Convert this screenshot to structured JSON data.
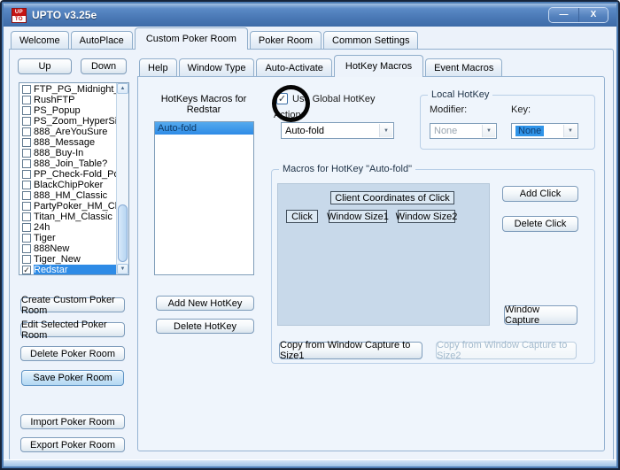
{
  "window": {
    "title": "UPTO  v3.25e",
    "logo": {
      "top": "UP",
      "bottom": "TO"
    },
    "minimize_glyph": "—",
    "close_glyph": "X"
  },
  "tabs": {
    "items": [
      "Welcome",
      "AutoPlace",
      "Custom Poker Room",
      "Poker Room",
      "Common Settings"
    ],
    "active": "Custom Poker Room"
  },
  "inner_tabs": {
    "items": [
      "Help",
      "Window Type",
      "Auto-Activate",
      "HotKey Macros",
      "Event Macros"
    ],
    "active": "HotKey Macros"
  },
  "left": {
    "up_label": "Up",
    "down_label": "Down",
    "rooms": [
      {
        "label": "FTP_PG_Midnight_F",
        "checked": false,
        "selected": false
      },
      {
        "label": "RushFTP",
        "checked": false,
        "selected": false
      },
      {
        "label": "PS_Popup",
        "checked": false,
        "selected": false
      },
      {
        "label": "PS_Zoom_HyperSim",
        "checked": false,
        "selected": false
      },
      {
        "label": "888_AreYouSure",
        "checked": false,
        "selected": false
      },
      {
        "label": "888_Message",
        "checked": false,
        "selected": false
      },
      {
        "label": "888_Buy-In",
        "checked": false,
        "selected": false
      },
      {
        "label": "888_Join_Table?",
        "checked": false,
        "selected": false
      },
      {
        "label": "PP_Check-Fold_Pop",
        "checked": false,
        "selected": false
      },
      {
        "label": "BlackChipPoker",
        "checked": false,
        "selected": false
      },
      {
        "label": "888_HM_Classic",
        "checked": false,
        "selected": false
      },
      {
        "label": "PartyPoker_HM_Clas",
        "checked": false,
        "selected": false
      },
      {
        "label": "Titan_HM_Classic",
        "checked": false,
        "selected": false
      },
      {
        "label": "24h",
        "checked": false,
        "selected": false
      },
      {
        "label": "Tiger",
        "checked": false,
        "selected": false
      },
      {
        "label": "888New",
        "checked": false,
        "selected": false
      },
      {
        "label": "Tiger_New",
        "checked": false,
        "selected": false
      },
      {
        "label": "Redstar",
        "checked": true,
        "selected": true
      }
    ],
    "buttons": {
      "create": "Create Custom Poker Room",
      "edit": "Edit Selected Poker Room",
      "delete": "Delete Poker Room",
      "save": "Save Poker Room",
      "import": "Import Poker Room",
      "export": "Export Poker Room"
    }
  },
  "hotkeys": {
    "title_line1": "HotKeys Macros for",
    "title_line2": "Redstar",
    "items": [
      {
        "label": "Auto-fold",
        "selected": true
      }
    ],
    "add_button": "Add New HotKey",
    "delete_button": "Delete HotKey"
  },
  "global_hotkey": {
    "checkbox_label": "Use Global HotKey",
    "checked": true,
    "action_label": "Action:",
    "action_value": "Auto-fold"
  },
  "local_hotkey": {
    "title": "Local HotKey",
    "modifier_label": "Modifier:",
    "modifier_value": "None",
    "key_label": "Key:",
    "key_value": "None"
  },
  "macros": {
    "title": "Macros for HotKey  \"Auto-fold\"",
    "table_header": "Client Coordinates of Click",
    "columns": [
      "Click",
      "Window Size1",
      "Window Size2"
    ],
    "buttons": {
      "add_click": "Add Click",
      "delete_click": "Delete Click",
      "window_capture": "Window Capture",
      "copy_size1": "Copy from Window Capture to Size1",
      "copy_size2": "Copy from Window Capture to Size2"
    },
    "copy_size2_disabled": true
  },
  "icons": {
    "check": "✓",
    "dropdown_arrow": "▼",
    "scroll_up": "▲",
    "scroll_down": "▼"
  },
  "colors": {
    "selection_blue": "#2E8BE6",
    "titlebar_blue": "#4E7DBA",
    "save_button_highlight": "#C6E2F7",
    "annotation_circle": "#000000"
  }
}
